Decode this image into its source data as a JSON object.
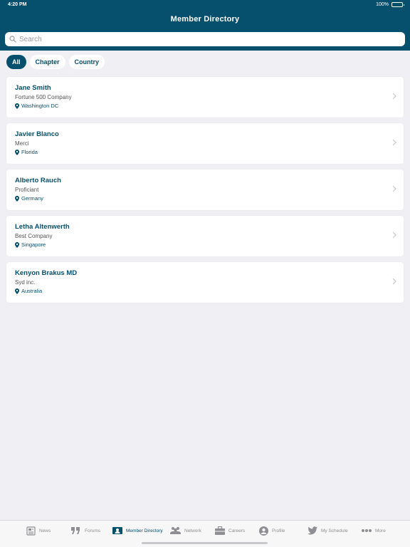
{
  "status": {
    "time": "4:20 PM",
    "battery": "100%"
  },
  "nav": {
    "title": "Member Directory"
  },
  "search": {
    "placeholder": "Search"
  },
  "filters": [
    {
      "label": "All",
      "active": true
    },
    {
      "label": "Chapter",
      "active": false
    },
    {
      "label": "Country",
      "active": false
    }
  ],
  "members": [
    {
      "name": "Jane Smith",
      "company": "Fortune 500 Company",
      "location": "Washington DC"
    },
    {
      "name": "Javier Blanco",
      "company": "Merci",
      "location": "Florida"
    },
    {
      "name": "Alberto Rauch",
      "company": "Proficiant",
      "location": "Germany"
    },
    {
      "name": "Letha Altenwerth",
      "company": "Best Company",
      "location": "Singapore"
    },
    {
      "name": "Kenyon Brakus MD",
      "company": "Syd inc.",
      "location": "Australia"
    }
  ],
  "tabs": [
    {
      "label": "News",
      "icon": "newspaper-icon",
      "active": false
    },
    {
      "label": "Forums",
      "icon": "quote-icon",
      "active": false
    },
    {
      "label": "Member Directory",
      "icon": "contact-card-icon",
      "active": true
    },
    {
      "label": "Network",
      "icon": "people-icon",
      "active": false
    },
    {
      "label": "Careers",
      "icon": "briefcase-icon",
      "active": false
    },
    {
      "label": "Profile",
      "icon": "user-circle-icon",
      "active": false
    },
    {
      "label": "My Schedule",
      "icon": "bird-icon",
      "active": false
    },
    {
      "label": "More",
      "icon": "more-dots-icon",
      "active": false
    }
  ],
  "colors": {
    "brand": "#07506d",
    "background": "#efeff4"
  }
}
